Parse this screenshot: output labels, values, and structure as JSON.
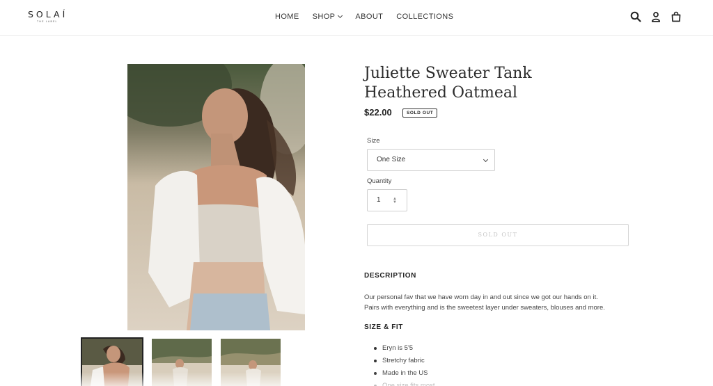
{
  "header": {
    "logo_text": "SOLAÍ",
    "logo_sub": "THE LABEL",
    "nav": [
      {
        "label": "HOME"
      },
      {
        "label": "SHOP"
      },
      {
        "label": "ABOUT"
      },
      {
        "label": "COLLECTIONS"
      }
    ],
    "icons": [
      "search-icon",
      "account-icon",
      "cart-icon"
    ]
  },
  "product": {
    "title": "Juliette Sweater Tank Heathered Oatmeal",
    "price": "$22.00",
    "badge": "SOLD OUT",
    "size_label": "Size",
    "size_value": "One Size",
    "quantity_label": "Quantity",
    "quantity_value": "1",
    "button_label": "SOLD OUT"
  },
  "description": {
    "heading": "DESCRIPTION",
    "line1": "Our personal fav that we have worn day in and out since we got our hands on it.",
    "line2": "Pairs with everything and is the sweetest layer under sweaters, blouses and more."
  },
  "size_fit": {
    "heading": "SIZE & FIT",
    "items": [
      "Eryn is 5'5",
      "Stretchy fabric",
      "Made in the US",
      "One size fits most"
    ]
  },
  "colors": {
    "text": "#3a3a3a",
    "border": "#cfcfcf",
    "soldout_text": "#c6c6c6"
  }
}
